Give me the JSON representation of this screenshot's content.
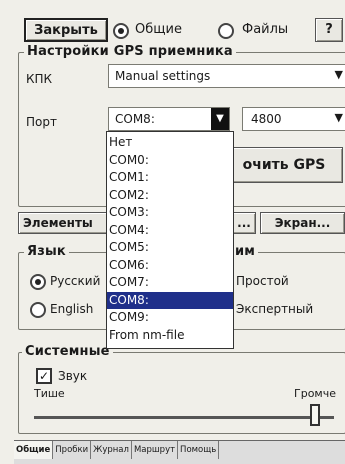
{
  "toolbar": {
    "close_label": "Закрыть",
    "radio_general": "Общие",
    "radio_files": "Файлы",
    "help_label": "?"
  },
  "gps": {
    "legend": "Настройки GPS приемника",
    "kpk_label": "КПК",
    "kpk_value": "Manual settings",
    "port_label": "Порт",
    "port_value": "COM8:",
    "baud_value": "4800",
    "check_button": "очить GPS"
  },
  "port_dropdown": {
    "options": [
      "Нет",
      "COM0:",
      "COM1:",
      "COM2:",
      "COM3:",
      "COM4:",
      "COM5:",
      "COM6:",
      "COM7:",
      "COM8:",
      "COM9:",
      "From nm-file"
    ],
    "selected": "COM8:"
  },
  "middle_buttons": {
    "elements": "Элементы",
    "dots": "...",
    "screen": "Экран..."
  },
  "language": {
    "legend": "Язык",
    "russian": "Русский",
    "english": "English"
  },
  "mode": {
    "legend": "им",
    "simple": "Простой",
    "expert": "Экспертный"
  },
  "system": {
    "legend": "Системные",
    "sound": "Звук",
    "quieter": "Тише",
    "louder": "Громче",
    "volume_level": 0.95
  },
  "tabs": [
    "Общие",
    "Пробки",
    "Журнал",
    "Маршрут",
    "Помощь"
  ]
}
